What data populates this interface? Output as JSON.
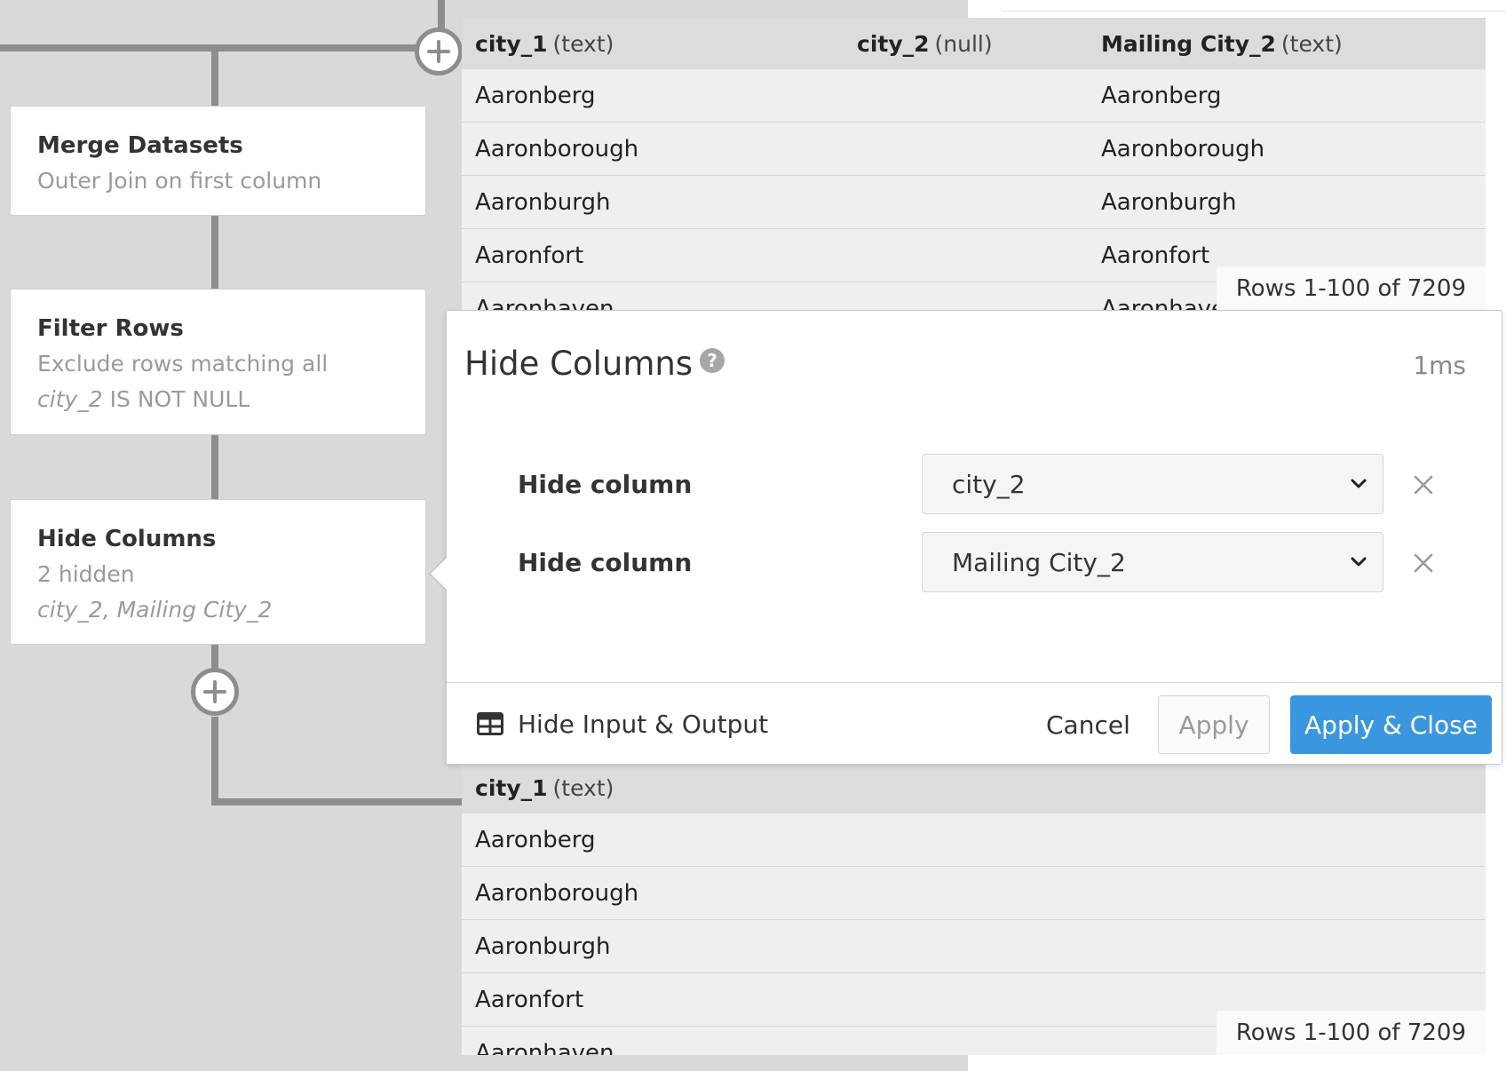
{
  "steps": [
    {
      "title": "Merge Datasets",
      "subtitle": "Outer Join on first column"
    },
    {
      "title": "Filter Rows",
      "subtitle": "Exclude rows matching all",
      "detail_italic": "city_2",
      "detail_rest": " IS NOT NULL"
    },
    {
      "title": "Hide Columns",
      "subtitle": "2 hidden",
      "detail_italic": "city_2, Mailing City_2"
    }
  ],
  "input_table": {
    "columns": [
      {
        "name": "city_1",
        "type": "(text)"
      },
      {
        "name": "city_2",
        "type": "(null)"
      },
      {
        "name": "Mailing City_2",
        "type": "(text)"
      }
    ],
    "rows": [
      [
        "Aaronberg",
        "",
        "Aaronberg"
      ],
      [
        "Aaronborough",
        "",
        "Aaronborough"
      ],
      [
        "Aaronburgh",
        "",
        "Aaronburgh"
      ],
      [
        "Aaronfort",
        "",
        "Aaronfort"
      ],
      [
        "Aaronhaven",
        "",
        "Aaronhaven"
      ]
    ],
    "row_count": "Rows 1-100 of 7209"
  },
  "output_table": {
    "columns": [
      {
        "name": "city_1",
        "type": "(text)"
      }
    ],
    "rows": [
      [
        "Aaronberg"
      ],
      [
        "Aaronborough"
      ],
      [
        "Aaronburgh"
      ],
      [
        "Aaronfort"
      ],
      [
        "Aaronhaven"
      ]
    ],
    "row_count": "Rows 1-100 of 7209"
  },
  "modal": {
    "title": "Hide Columns",
    "help_icon": "question-circle-icon",
    "timing": "1ms",
    "fields": [
      {
        "label": "Hide column",
        "value": "city_2"
      },
      {
        "label": "Hide column",
        "value": "Mailing City_2"
      }
    ],
    "footer": {
      "toggle_label": "Hide Input & Output",
      "cancel_label": "Cancel",
      "apply_label": "Apply",
      "apply_close_label": "Apply & Close"
    }
  },
  "colors": {
    "primary_button": "#3a97df",
    "connector": "#8d8d8d",
    "canvas": "#d8d9db"
  }
}
